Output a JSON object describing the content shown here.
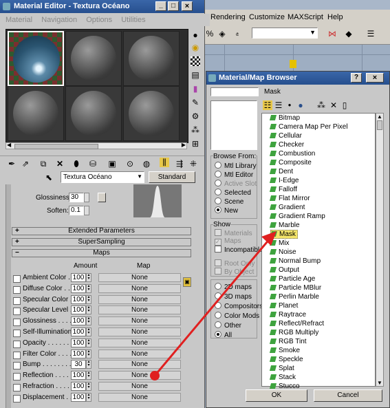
{
  "main_window": {
    "menu": [
      "Rendering",
      "Customize",
      "MAXScript",
      "Help"
    ],
    "title_controls": [
      "_",
      "□",
      "×"
    ]
  },
  "material_editor": {
    "title": "Material Editor - Textura Océano",
    "menu": [
      "Material",
      "Navigation",
      "Options",
      "Utilities"
    ],
    "title_controls": [
      "_",
      "□",
      "×"
    ],
    "material_name": "Textura Océano",
    "material_type": "Standard",
    "glossiness_label": "Glossiness:",
    "glossiness_value": "30",
    "soften_label": "Soften:",
    "soften_value": "0.1",
    "rollouts": {
      "extended": "Extended Parameters",
      "supersampling": "SuperSampling",
      "maps": "Maps"
    },
    "maps_headers": {
      "amount": "Amount",
      "map": "Map"
    },
    "maps": [
      {
        "label": "Ambient Color",
        "dots": " . . . . .",
        "amount": "100",
        "map": "None"
      },
      {
        "label": "Diffuse Color",
        "dots": " . . . . .",
        "amount": "100",
        "map": "None"
      },
      {
        "label": "Specular Color",
        "dots": " . . .",
        "amount": "100",
        "map": "None"
      },
      {
        "label": "Specular Level",
        "dots": " . .",
        "amount": "100",
        "map": "None"
      },
      {
        "label": "Glossiness",
        "dots": " . . . . . .",
        "amount": "100",
        "map": "None"
      },
      {
        "label": "Self-Illumination",
        "dots": " .",
        "amount": "100",
        "map": "None"
      },
      {
        "label": "Opacity",
        "dots": " . . . . . . . .",
        "amount": "100",
        "map": "None"
      },
      {
        "label": "Filter Color",
        "dots": " . . . . . .",
        "amount": "100",
        "map": "None"
      },
      {
        "label": "Bump",
        "dots": " . . . . . . . . . .",
        "amount": "30",
        "map": "None"
      },
      {
        "label": "Reflection",
        "dots": " . . . . .",
        "amount": "100",
        "map": "None"
      },
      {
        "label": "Refraction",
        "dots": " . . . . .",
        "amount": "100",
        "map": "None"
      },
      {
        "label": "Displacement",
        "dots": " . .",
        "amount": "100",
        "map": "None"
      }
    ]
  },
  "map_browser": {
    "title": "Material/Map Browser",
    "title_controls": [
      "?",
      "×"
    ],
    "selected_name": "Mask",
    "browse_from": {
      "title": "Browse From:",
      "options": [
        "Mtl Library",
        "Mtl Editor",
        "Active Slot",
        "Selected",
        "Scene",
        "New"
      ],
      "selected": "New"
    },
    "show": {
      "title": "Show",
      "options": [
        "Materials",
        "Maps",
        "Incompatible"
      ],
      "extra": [
        "Root Only",
        "By Object"
      ]
    },
    "map_filter": {
      "options": [
        "2D maps",
        "3D maps",
        "Compositors",
        "Color Mods",
        "Other",
        "All"
      ],
      "selected": "All"
    },
    "list": [
      "Bitmap",
      "Camera Map Per Pixel",
      "Cellular",
      "Checker",
      "Combustion",
      "Composite",
      "Dent",
      "Falloff",
      "Flat Mirror",
      "Gradient",
      "Gradient Ramp",
      "Marble",
      "Mask",
      "Mix",
      "Noise",
      "Normal Bump",
      "Output",
      "Particle Age",
      "Particle MBlur",
      "Perlin Marble",
      "Planet",
      "Raytrace",
      "Reflect/Refract",
      "RGB Multiply",
      "RGB Tint",
      "Smoke",
      "Speckle",
      "Splat",
      "Stack",
      "Stucco"
    ],
    "list_edge_item": "I-Edge",
    "selected_item": "Mask",
    "ok_label": "OK",
    "cancel_label": "Cancel"
  },
  "colors": {
    "title_bar": "#2f5b9e",
    "selection": "#f5e66a",
    "arrow": "#e02020"
  }
}
